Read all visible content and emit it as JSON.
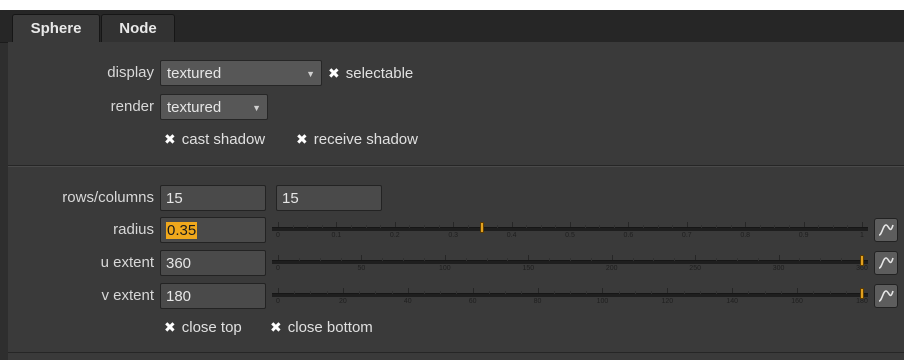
{
  "tabs": [
    {
      "label": "Sphere",
      "active": true
    },
    {
      "label": "Node",
      "active": false
    }
  ],
  "display": {
    "label": "display",
    "value": "textured"
  },
  "selectable": {
    "label": "selectable",
    "checked": true
  },
  "render": {
    "label": "render",
    "value": "textured"
  },
  "cast_shadow": {
    "label": "cast shadow",
    "checked": true
  },
  "receive_shadow": {
    "label": "receive shadow",
    "checked": true
  },
  "rows_columns": {
    "label": "rows/columns",
    "rows": "15",
    "columns": "15"
  },
  "radius": {
    "label": "radius",
    "value": "0.35",
    "slider": {
      "min": 0,
      "max": 1,
      "value": 0.35,
      "tick_labels": [
        "0",
        "0.1",
        "0.2",
        "0.3",
        "0.4",
        "0.5",
        "0.6",
        "0.7",
        "0.8",
        "0.9",
        "1"
      ]
    }
  },
  "u_extent": {
    "label": "u extent",
    "value": "360",
    "slider": {
      "min": 0,
      "max": 360,
      "value": 360,
      "tick_labels": [
        "0",
        "50",
        "100",
        "150",
        "200",
        "250",
        "300",
        "360"
      ]
    }
  },
  "v_extent": {
    "label": "v extent",
    "value": "180",
    "slider": {
      "min": 0,
      "max": 180,
      "value": 180,
      "tick_labels": [
        "0",
        "20",
        "40",
        "60",
        "80",
        "100",
        "120",
        "140",
        "160",
        "180"
      ]
    }
  },
  "close_top": {
    "label": "close top",
    "checked": true
  },
  "close_bottom": {
    "label": "close bottom",
    "checked": true
  },
  "colors": {
    "accent": "#f0a81c",
    "panel": "#3a3a3a",
    "field": "#4a4a4a"
  }
}
